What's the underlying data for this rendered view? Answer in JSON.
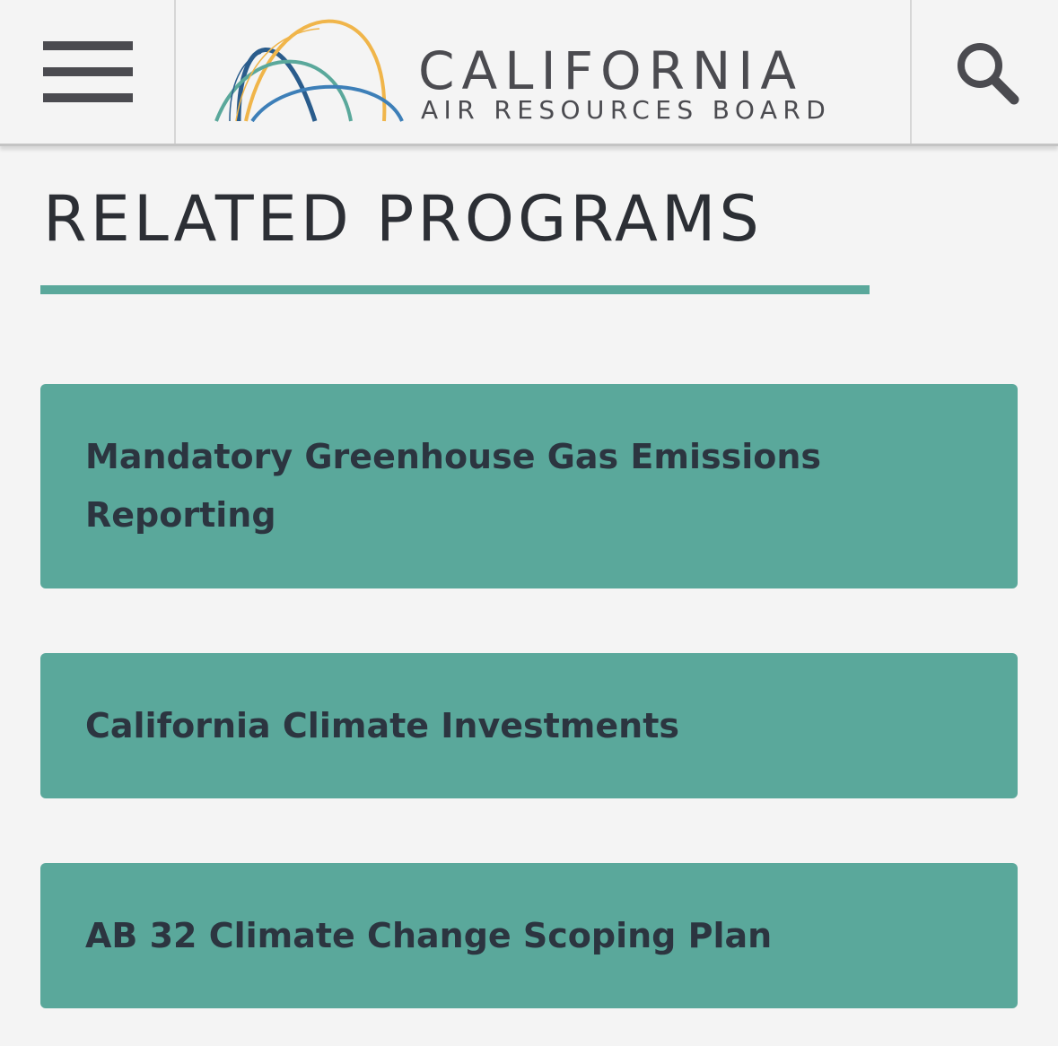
{
  "header": {
    "logo": {
      "title": "CALIFORNIA",
      "subtitle": "AIR RESOURCES BOARD",
      "arc_colors": [
        "#2a5c8c",
        "#f0b54a",
        "#5aa89b",
        "#3d7fb8"
      ]
    },
    "menu_icon": "hamburger-icon",
    "search_icon": "search-icon",
    "icon_color": "#4b4b50"
  },
  "main": {
    "section_title": "RELATED PROGRAMS",
    "accent_color": "#5aa89b",
    "programs": [
      {
        "label": "Mandatory Greenhouse Gas Emissions Reporting"
      },
      {
        "label": "California Climate Investments"
      },
      {
        "label": "AB 32 Climate Change Scoping Plan"
      }
    ]
  }
}
